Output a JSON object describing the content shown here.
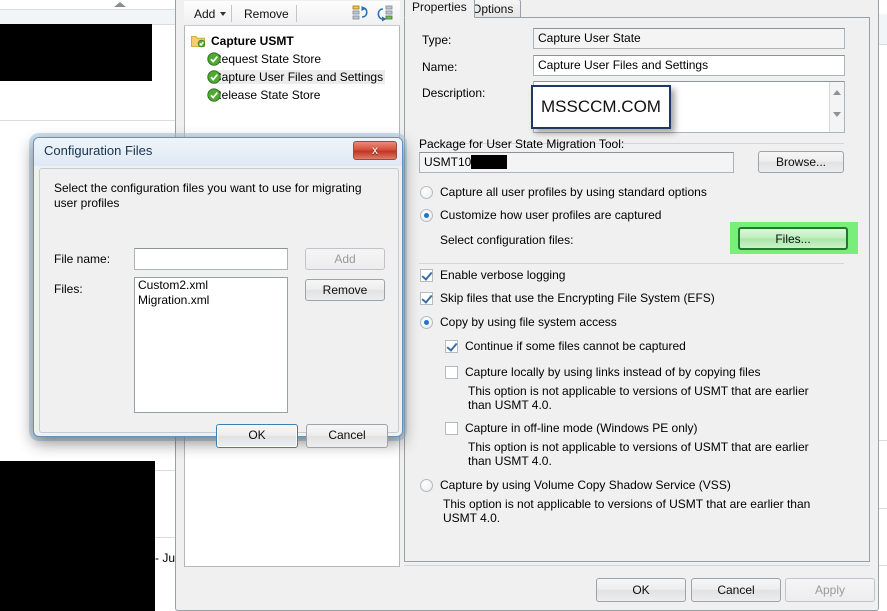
{
  "background": {
    "note_text": "- Ju"
  },
  "step_panel": {
    "toolbar": {
      "add_label": "Add",
      "remove_label": "Remove",
      "icon_move_up": "move-up-icon",
      "icon_move_down": "move-down-icon"
    },
    "tree": {
      "root": {
        "label": "Capture USMT",
        "icon": "folder-check-icon"
      },
      "children": [
        {
          "label": "Request State Store",
          "icon": "green-check-icon",
          "selected": false
        },
        {
          "label": "Capture User Files and Settings",
          "icon": "green-check-icon",
          "selected": true
        },
        {
          "label": "Release State Store",
          "icon": "green-check-icon",
          "selected": false
        }
      ]
    }
  },
  "tabs": [
    {
      "label": "Properties",
      "active": true
    },
    {
      "label": "Options",
      "active": false
    }
  ],
  "properties": {
    "type_label": "Type:",
    "type_value": "Capture User State",
    "name_label": "Name:",
    "name_value": "Capture User Files and Settings",
    "description_label": "Description:",
    "description_value": "",
    "annotation": "MSSCCM.COM",
    "package_label": "Package for User State Migration Tool:",
    "package_value": "USMT10",
    "browse_label": "Browse...",
    "radio_standard": "Capture all user profiles by using standard options",
    "radio_customize": "Customize how user profiles are captured",
    "select_config_label": "Select configuration files:",
    "files_button_label": "Files...",
    "highlight_color": "#7aee7a",
    "check_verbose": "Enable verbose logging",
    "check_efs": "Skip files that use the Encrypting File System (EFS)",
    "radio_filesystem": "Copy by using file system access",
    "check_continue": "Continue if some files cannot be captured",
    "check_links": "Capture locally by using links instead of by copying files",
    "note_links": "This option is not applicable to versions of USMT that are earlier than USMT 4.0.",
    "check_offline": "Capture in off-line mode (Windows PE only)",
    "note_offline": "This option is not applicable to versions of USMT that are earlier than USMT 4.0.",
    "radio_vss": "Capture by using Volume Copy Shadow Service (VSS)",
    "note_vss": "This option is not applicable to versions of USMT that are earlier than USMT 4.0."
  },
  "footer": {
    "ok_label": "OK",
    "cancel_label": "Cancel",
    "apply_label": "Apply"
  },
  "config_dialog": {
    "title": "Configuration Files",
    "close_label": "x",
    "description": "Select the configuration files you want to use for migrating user profiles",
    "file_name_label": "File name:",
    "file_name_value": "",
    "add_label": "Add",
    "files_label": "Files:",
    "remove_label": "Remove",
    "files": [
      "Custom2.xml",
      "Migration.xml"
    ],
    "ok_label": "OK",
    "cancel_label": "Cancel"
  }
}
